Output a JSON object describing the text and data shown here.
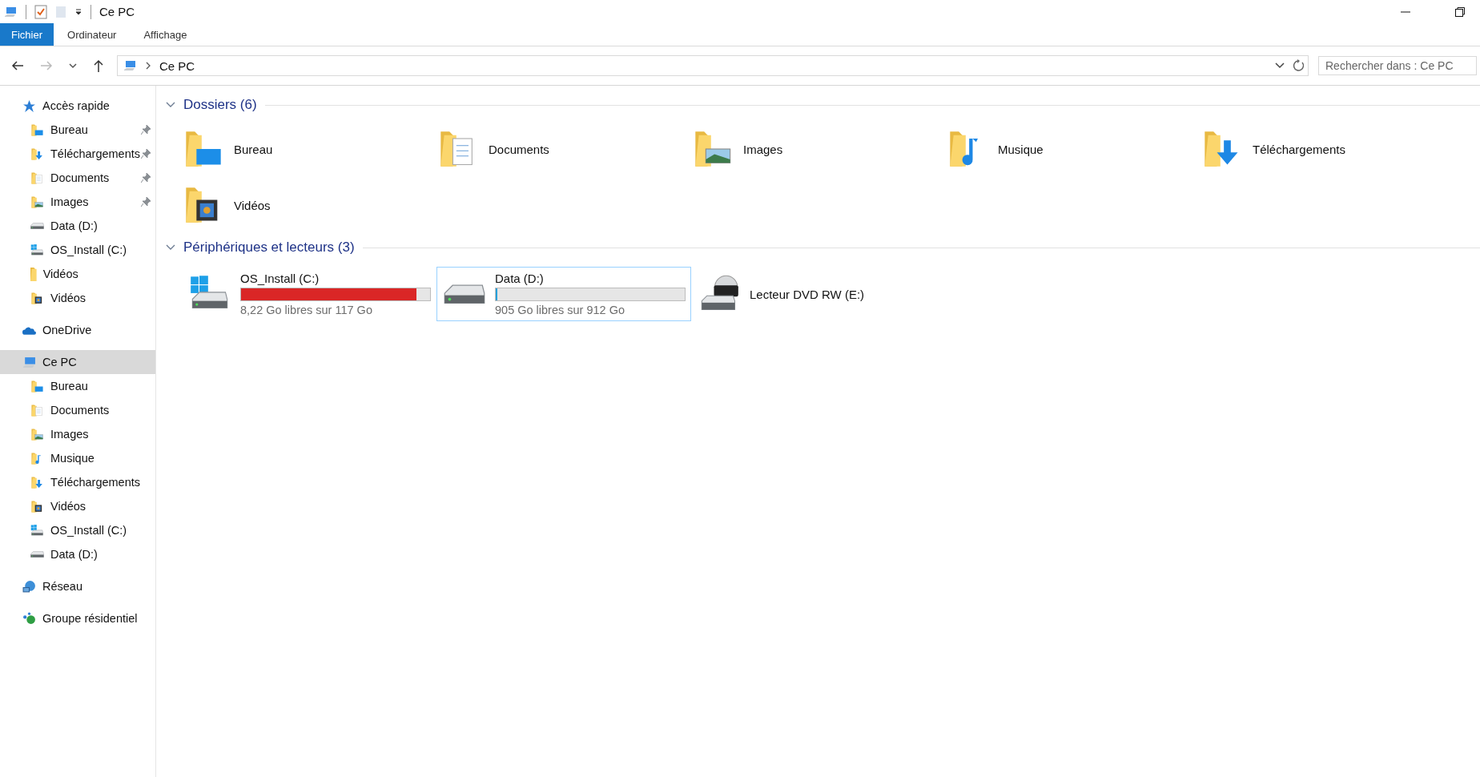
{
  "window": {
    "title": "Ce PC"
  },
  "ribbon_tabs": [
    {
      "label": "Fichier",
      "selected": true
    },
    {
      "label": "Ordinateur",
      "selected": false
    },
    {
      "label": "Affichage",
      "selected": false
    }
  ],
  "navigation": {
    "back_disabled": false,
    "forward_disabled": true
  },
  "address": {
    "path": "Ce PC"
  },
  "search": {
    "placeholder": "Rechercher dans : Ce PC"
  },
  "sidebar": {
    "items": [
      {
        "label": "Accès rapide",
        "kind": "star",
        "selected": false,
        "children": [
          {
            "label": "Bureau",
            "kind": "desktop",
            "pinned": true,
            "selected": false
          },
          {
            "label": "Téléchargements",
            "kind": "downloads",
            "pinned": true,
            "selected": false
          },
          {
            "label": "Documents",
            "kind": "documents",
            "pinned": true,
            "selected": false
          },
          {
            "label": "Images",
            "kind": "pictures",
            "pinned": true,
            "selected": false
          },
          {
            "label": "Data (D:)",
            "kind": "drive",
            "pinned": false,
            "selected": false
          },
          {
            "label": "OS_Install (C:)",
            "kind": "osdrive",
            "pinned": false,
            "selected": false
          },
          {
            "label": "Vidéos",
            "kind": "folder",
            "pinned": false,
            "selected": false
          },
          {
            "label": "Vidéos",
            "kind": "videos",
            "pinned": false,
            "selected": false
          }
        ]
      },
      {
        "label": "OneDrive",
        "kind": "cloud",
        "selected": false
      },
      {
        "label": "Ce PC",
        "kind": "pc",
        "selected": true,
        "children": [
          {
            "label": "Bureau",
            "kind": "desktop",
            "pinned": false,
            "selected": false
          },
          {
            "label": "Documents",
            "kind": "documents",
            "pinned": false,
            "selected": false
          },
          {
            "label": "Images",
            "kind": "pictures",
            "pinned": false,
            "selected": false
          },
          {
            "label": "Musique",
            "kind": "music",
            "pinned": false,
            "selected": false
          },
          {
            "label": "Téléchargements",
            "kind": "downloads",
            "pinned": false,
            "selected": false
          },
          {
            "label": "Vidéos",
            "kind": "videos",
            "pinned": false,
            "selected": false
          },
          {
            "label": "OS_Install (C:)",
            "kind": "osdrive",
            "pinned": false,
            "selected": false
          },
          {
            "label": "Data (D:)",
            "kind": "drive",
            "pinned": false,
            "selected": false
          }
        ]
      },
      {
        "label": "Réseau",
        "kind": "network",
        "selected": false
      },
      {
        "label": "Groupe résidentiel",
        "kind": "homegroup",
        "selected": false
      }
    ]
  },
  "sections": [
    {
      "title": "Dossiers (6)",
      "expanded": true,
      "items": [
        {
          "label": "Bureau",
          "kind": "desktop",
          "selected": false
        },
        {
          "label": "Documents",
          "kind": "documents",
          "selected": false
        },
        {
          "label": "Images",
          "kind": "pictures",
          "selected": false
        },
        {
          "label": "Musique",
          "kind": "music",
          "selected": false
        },
        {
          "label": "Téléchargements",
          "kind": "downloads",
          "selected": false
        },
        {
          "label": "Vidéos",
          "kind": "videos",
          "selected": false
        }
      ]
    },
    {
      "title": "Périphériques et lecteurs (3)",
      "expanded": true,
      "items": [
        {
          "label": "OS_Install (C:)",
          "kind": "osdrive",
          "level": 0.93,
          "color": "#da2626",
          "space": "8,22 Go libres sur 117 Go",
          "selected": false
        },
        {
          "label": "Data (D:)",
          "kind": "drive",
          "level": 0.008,
          "color": "#26a0da",
          "space": "905 Go libres sur 912 Go",
          "selected": true
        },
        {
          "label": "Lecteur DVD RW (E:)",
          "kind": "dvd",
          "selected": false
        }
      ]
    }
  ]
}
